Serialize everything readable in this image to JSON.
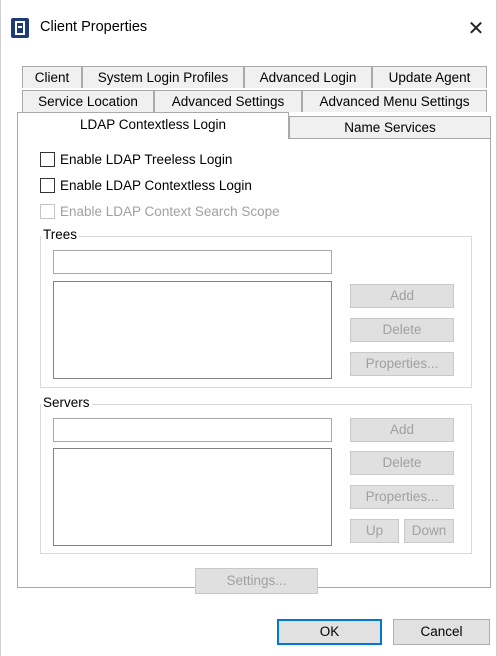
{
  "window": {
    "title": "Client Properties",
    "icon": "novell-client-icon",
    "close_glyph": "✕"
  },
  "tabs": {
    "row1": [
      "Client",
      "System Login Profiles",
      "Advanced Login",
      "Update Agent"
    ],
    "row2": [
      "Service Location",
      "Advanced Settings",
      "Advanced Menu Settings"
    ],
    "row3": [
      "LDAP Contextless Login",
      "Name Services"
    ],
    "active": "LDAP Contextless Login"
  },
  "options": {
    "treeless": {
      "label": "Enable LDAP Treeless Login",
      "checked": false,
      "enabled": true
    },
    "contextless": {
      "label": "Enable LDAP Contextless Login",
      "checked": false,
      "enabled": true
    },
    "context_search": {
      "label": "Enable LDAP Context Search Scope",
      "checked": false,
      "enabled": false
    }
  },
  "trees": {
    "label": "Trees",
    "input_value": "",
    "items": [],
    "add_label": "Add",
    "delete_label": "Delete",
    "properties_label": "Properties..."
  },
  "servers": {
    "label": "Servers",
    "input_value": "",
    "items": [],
    "add_label": "Add",
    "delete_label": "Delete",
    "properties_label": "Properties...",
    "up_label": "Up",
    "down_label": "Down"
  },
  "settings_label": "Settings...",
  "footer": {
    "ok_label": "OK",
    "cancel_label": "Cancel"
  },
  "colors": {
    "accent": "#0078d7",
    "tab_bg": "#f0f0f0",
    "disabled_text": "#a0a0a0"
  }
}
